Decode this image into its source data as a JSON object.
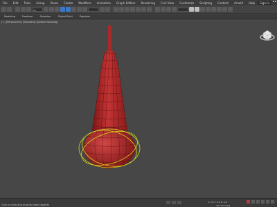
{
  "menubar": {
    "items": [
      "File",
      "Edit",
      "Tools",
      "Group",
      "Views",
      "Create",
      "Modifiers",
      "Animation",
      "Graph Editors",
      "Rendering",
      "Civil View",
      "Customize",
      "Scripting",
      "Content",
      "Arnold",
      "Help"
    ],
    "signin_label": "Sign In"
  },
  "toolbar": {
    "selection_filter": "All"
  },
  "ribbon": {
    "tabs": [
      "Modeling",
      "Freeform",
      "Selection",
      "Object Paint",
      "Populate"
    ]
  },
  "viewport": {
    "label": "[+] [Perspective] [Standard] [Default Shading]",
    "model_color": "#b52a2a",
    "gizmo_color": "#d6d61c"
  },
  "statusbar": {
    "message": "Click or click-and-drag to select objects",
    "coordinates": "X: 0.0   Y: 0.0   Z: 0.0",
    "add_time_tag": "Add Time Tag"
  }
}
